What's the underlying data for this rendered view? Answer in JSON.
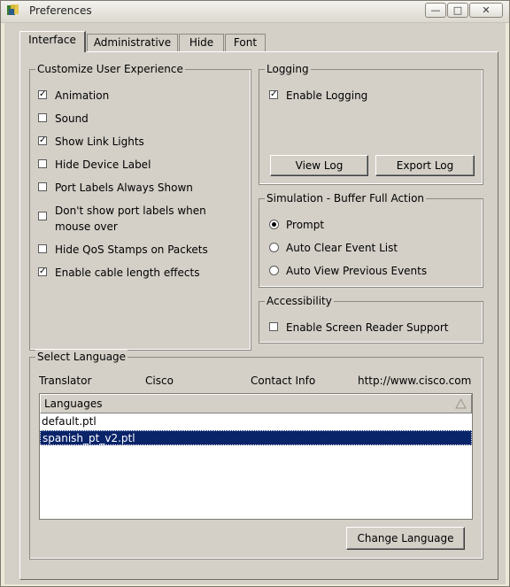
{
  "window": {
    "title": "Preferences",
    "controls": {
      "minimize": "—",
      "maximize": "□",
      "close": "✕"
    }
  },
  "tabs": [
    {
      "label": "Interface",
      "active": true
    },
    {
      "label": "Administrative",
      "active": false
    },
    {
      "label": "Hide",
      "active": false
    },
    {
      "label": "Font",
      "active": false
    }
  ],
  "customize": {
    "legend": "Customize User Experience",
    "options": [
      {
        "label": "Animation",
        "checked": true
      },
      {
        "label": "Sound",
        "checked": false
      },
      {
        "label": "Show Link Lights",
        "checked": true
      },
      {
        "label": "Hide Device Label",
        "checked": false
      },
      {
        "label": "Port Labels Always Shown",
        "checked": false
      },
      {
        "label": "Don't show port labels when",
        "label2": "mouse over",
        "checked": false
      },
      {
        "label": "Hide QoS Stamps on Packets",
        "checked": false
      },
      {
        "label": "Enable cable length effects",
        "checked": true
      }
    ]
  },
  "logging": {
    "legend": "Logging",
    "enable_label": "Enable Logging",
    "enable_checked": true,
    "view_log": "View Log",
    "export_log": "Export Log"
  },
  "simulation": {
    "legend": "Simulation - Buffer Full Action",
    "options": [
      {
        "label": "Prompt",
        "selected": true
      },
      {
        "label": "Auto Clear Event List",
        "selected": false
      },
      {
        "label": "Auto View Previous Events",
        "selected": false
      }
    ]
  },
  "accessibility": {
    "legend": "Accessibility",
    "screen_reader_label": "Enable Screen Reader Support",
    "screen_reader_checked": false
  },
  "language": {
    "legend": "Select Language",
    "translator_label": "Translator",
    "translator_value": "Cisco",
    "contact_label": "Contact Info",
    "contact_value": "http://www.cisco.com",
    "column_header": "Languages",
    "sort_icon": "sort-triangle-icon",
    "items": [
      {
        "label": "default.ptl",
        "selected": false
      },
      {
        "label": "spanish_pt_v2.ptl",
        "selected": true
      }
    ],
    "change_button": "Change Language"
  },
  "colors": {
    "selection": "#0a246a",
    "face": "#d4d0c8"
  }
}
